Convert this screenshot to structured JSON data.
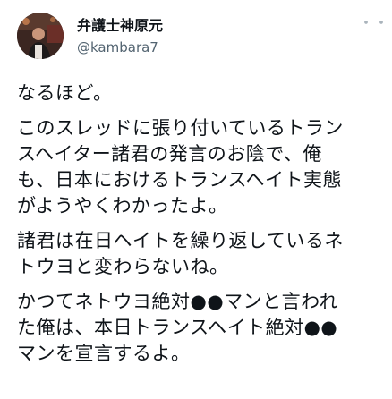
{
  "profile": {
    "display_name": "弁護士神原元",
    "handle": "@kambara7",
    "avatar_icon": "avatar-photo"
  },
  "header": {
    "more_label": "・・・",
    "more_icon": "more-options-icon"
  },
  "tweet": {
    "paragraphs": [
      "なるほど。",
      "このスレッドに張り付いているトラン\nスヘイター諸君の発言のお陰で、俺\nも、日本におけるトランスヘイト実態\nがようやくわかったよ。",
      "諸君は在日ヘイトを繰り返しているネ\nトウヨと変わらないね。",
      "かつてネトウヨ絶対●●マンと言われ\nた俺は、本日トランスヘイト絶対●●\nマンを宣言するよ。"
    ]
  }
}
